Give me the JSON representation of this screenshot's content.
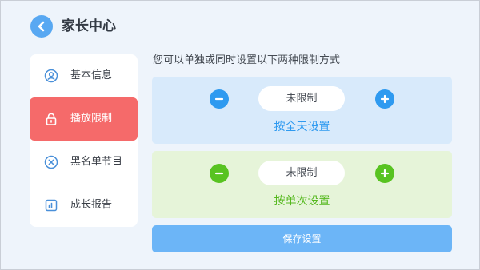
{
  "header": {
    "back_icon": "chevron-left-icon",
    "title": "家长中心"
  },
  "sidebar": {
    "items": [
      {
        "label": "基本信息",
        "icon": "user-icon",
        "active": false
      },
      {
        "label": "播放限制",
        "icon": "lock-icon",
        "active": true
      },
      {
        "label": "黑名单节目",
        "icon": "block-icon",
        "active": false
      },
      {
        "label": "成长报告",
        "icon": "chart-icon",
        "active": false
      }
    ]
  },
  "main": {
    "instruction": "您可以单独或同时设置以下两种限制方式",
    "daily_limit": {
      "value": "未限制",
      "label": "按全天设置",
      "color": "#2e9af0"
    },
    "per_session_limit": {
      "value": "未限制",
      "label": "按单次设置",
      "color": "#58c321"
    },
    "save_label": "保存设置"
  },
  "colors": {
    "accent_blue": "#58a8f2",
    "active_red": "#f56a6a",
    "save_blue": "#6cb5f7"
  }
}
